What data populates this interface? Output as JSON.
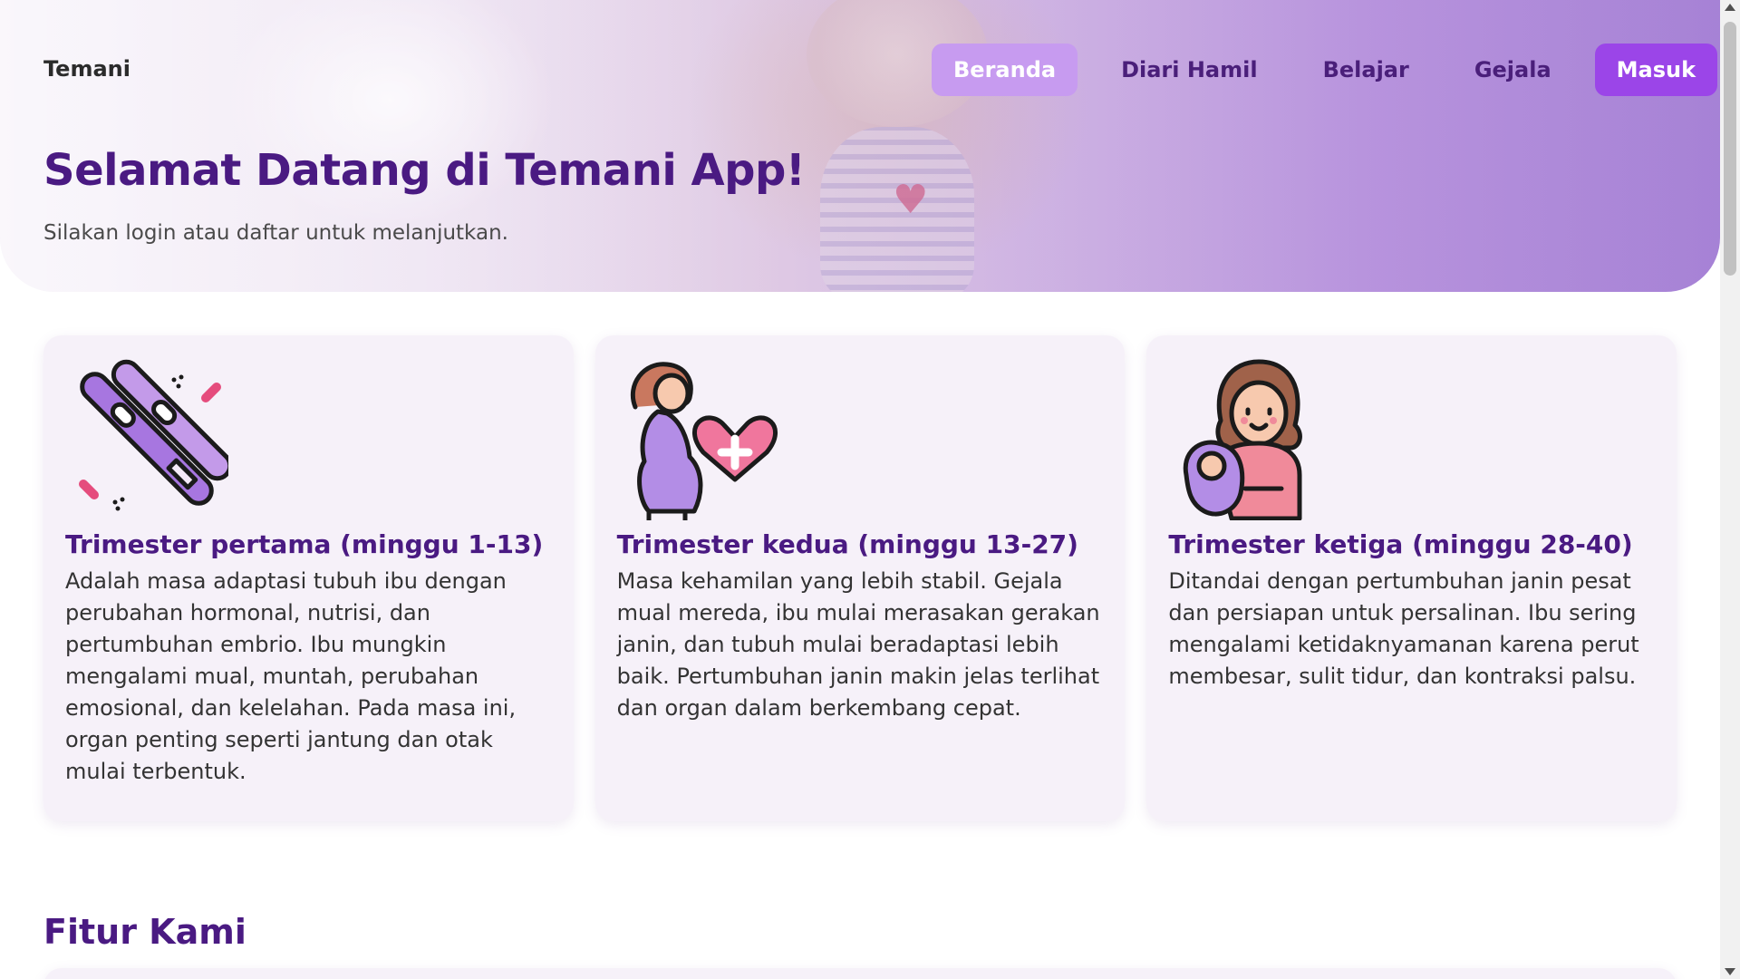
{
  "header": {
    "brand": "Temani",
    "nav": [
      {
        "label": "Beranda",
        "active": true
      },
      {
        "label": "Diari Hamil",
        "active": false
      },
      {
        "label": "Belajar",
        "active": false
      },
      {
        "label": "Gejala",
        "active": false
      }
    ],
    "login_label": "Masuk"
  },
  "hero": {
    "title": "Selamat Datang di Temani App!",
    "subtitle": "Silakan login atau daftar untuk melanjutkan."
  },
  "cards": [
    {
      "icon": "pregnancy-test-icon",
      "title": "Trimester pertama (minggu 1-13)",
      "text": "Adalah masa adaptasi tubuh ibu dengan perubahan hormonal, nutrisi, dan pertumbuhan embrio. Ibu mungkin mengalami mual, muntah, perubahan emosional, dan kelelahan. Pada masa ini, organ penting seperti jantung dan otak mulai terbentuk."
    },
    {
      "icon": "pregnant-woman-heart-icon",
      "title": "Trimester kedua (minggu 13-27)",
      "text": "Masa kehamilan yang lebih stabil. Gejala mual mereda, ibu mulai merasakan gerakan janin, dan tubuh mulai beradaptasi lebih baik. Pertumbuhan janin makin jelas terlihat dan organ dalam berkembang cepat."
    },
    {
      "icon": "mother-baby-icon",
      "title": "Trimester ketiga (minggu 28-40)",
      "text": "Ditandai dengan pertumbuhan janin pesat dan persiapan untuk persalinan. Ibu sering mengalami ketidaknyamanan karena perut membesar, sulit tidur, dan kontraksi palsu."
    }
  ],
  "features": {
    "title": "Fitur Kami"
  },
  "colors": {
    "primary": "#4a1a82",
    "accent": "#9b45e8",
    "nav_active": "#c79bf0",
    "card_bg": "#f6f1f9"
  }
}
